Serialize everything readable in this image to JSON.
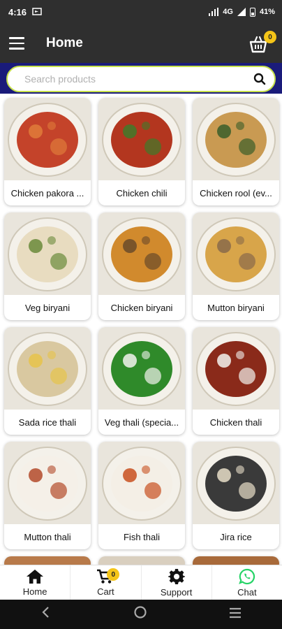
{
  "status_bar": {
    "time": "4:16",
    "network": "4G",
    "battery": "41%"
  },
  "app_bar": {
    "title": "Home",
    "cart_count": "0"
  },
  "search": {
    "placeholder": "Search products"
  },
  "products": [
    {
      "name": "Chicken pakora ...",
      "colors": [
        "#c4432a",
        "#e07b3a"
      ]
    },
    {
      "name": "Chicken chili",
      "colors": [
        "#b3361f",
        "#3f7a2a"
      ]
    },
    {
      "name": "Chicken rool (ev...",
      "colors": [
        "#c99a52",
        "#3a5e2a"
      ]
    },
    {
      "name": "Veg biryani",
      "colors": [
        "#e8dcc0",
        "#6a8a3a"
      ]
    },
    {
      "name": "Chicken biryani",
      "colors": [
        "#d18a2d",
        "#6a4a2a"
      ]
    },
    {
      "name": "Mutton biryani",
      "colors": [
        "#d8a54a",
        "#8a6a4a"
      ]
    },
    {
      "name": "Sada rice thali",
      "colors": [
        "#d9c8a0",
        "#e6c34a"
      ]
    },
    {
      "name": "Veg thali (specia...",
      "colors": [
        "#2f8a2a",
        "#f2f2ee"
      ]
    },
    {
      "name": "Chicken thali",
      "colors": [
        "#8a2a1a",
        "#f2f2ee"
      ]
    },
    {
      "name": "Mutton thali",
      "colors": [
        "#f5f0e8",
        "#b34a2a"
      ]
    },
    {
      "name": "Fish thali",
      "colors": [
        "#f4efe6",
        "#c8501f"
      ]
    },
    {
      "name": "Jira rice",
      "colors": [
        "#3a3a3a",
        "#e8dec8"
      ]
    }
  ],
  "bottom_nav": [
    {
      "label": "Home",
      "icon": "home-icon"
    },
    {
      "label": "Cart",
      "icon": "cart-icon",
      "badge": "0"
    },
    {
      "label": "Support",
      "icon": "gear-icon"
    },
    {
      "label": "Chat",
      "icon": "whatsapp-icon"
    }
  ]
}
